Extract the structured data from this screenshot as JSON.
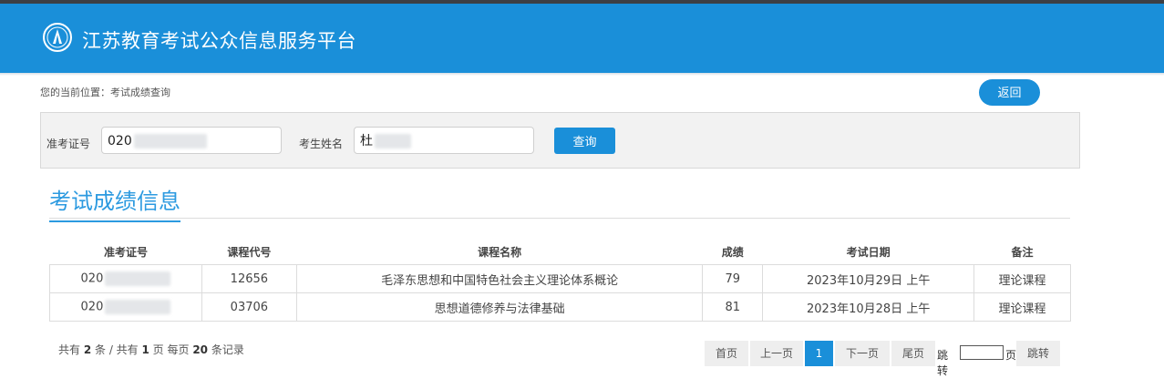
{
  "header": {
    "site_title": "江苏教育考试公众信息服务平台",
    "logo": "jiangsu-exam-logo"
  },
  "breadcrumb": "您的当前位置：考试成绩查询",
  "back_label": "返回",
  "search": {
    "ticket_label": "准考证号",
    "ticket_value": "020",
    "name_label": "考生姓名",
    "name_value": "杜",
    "query_label": "查询"
  },
  "section_title": "考试成绩信息",
  "table": {
    "headers": [
      "准考证号",
      "课程代号",
      "课程名称",
      "成绩",
      "考试日期",
      "备注"
    ],
    "rows": [
      {
        "ticket": "020",
        "code": "12656",
        "course": "毛泽东思想和中国特色社会主义理论体系概论",
        "score": "79",
        "date": "2023年10月29日 上午",
        "note": "理论课程"
      },
      {
        "ticket": "020",
        "code": "03706",
        "course": "思想道德修养与法律基础",
        "score": "81",
        "date": "2023年10月28日 上午",
        "note": "理论课程"
      }
    ]
  },
  "summary": {
    "p1": "共有 ",
    "total": "2",
    "p2": " 条 / 共有 ",
    "pages": "1",
    "p3": " 页 每页 ",
    "per_page": "20",
    "p4": " 条记录"
  },
  "pagination": {
    "first": "首页",
    "prev": "上一页",
    "current": "1",
    "next": "下一页",
    "last": "尾页",
    "jump_prefix": "跳转",
    "jump_suffix": "页",
    "jump_button": "跳转"
  },
  "colors": {
    "primary": "#1a8fd9",
    "title": "#2c9ae0"
  }
}
